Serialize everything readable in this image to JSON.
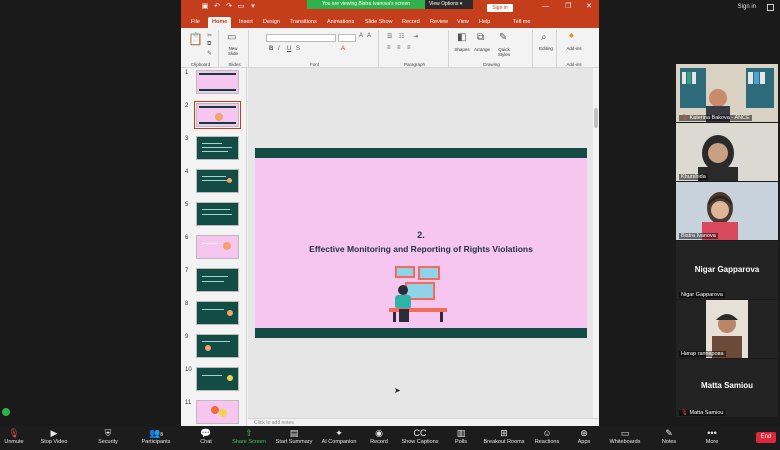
{
  "zoom_top": {
    "signin": "Sign in"
  },
  "ppt": {
    "banner": "You are viewing Bistra Ivanova's screen",
    "view_options": "View Options",
    "signin": "Sign in",
    "tabs": [
      "File",
      "Home",
      "Insert",
      "Design",
      "Transitions",
      "Animations",
      "Slide Show",
      "Record",
      "Review",
      "View",
      "Help",
      "Tell me"
    ],
    "ribbon": {
      "clipboard": "Clipboard",
      "slides": "Slides",
      "new_slide": "New Slide",
      "font": "Font",
      "paragraph": "Paragraph",
      "drawing": "Drawing",
      "shapes": "Shapes",
      "arrange": "Arrange",
      "quick_styles": "Quick Styles",
      "editing": "Editing",
      "addins": "Add-ins",
      "addins_group": "Add-ins"
    },
    "thumbnails": [
      "1",
      "2",
      "3",
      "4",
      "5",
      "6",
      "7",
      "8",
      "9",
      "10",
      "11"
    ],
    "slide": {
      "number": "2.",
      "title": "Effective Monitoring and Reporting of Rights Violations"
    },
    "notes_placeholder": "Click to add notes"
  },
  "participants": [
    {
      "name": "Katerina Bakova - ANCE",
      "muted": true
    },
    {
      "name": "Khurshida",
      "muted": false
    },
    {
      "name": "Bistra Ivanova",
      "muted": false
    },
    {
      "name": "Nigar Gapparova",
      "big_name": "Nigar Gapparova"
    },
    {
      "name": "Нигар гаппарова"
    },
    {
      "name": "Matta Samiou",
      "big_name": "Matta Samiou",
      "muted": true
    }
  ],
  "toolbar": {
    "unmute": "Unmute",
    "stop_video": "Stop Video",
    "security": "Security",
    "participants": "Participants",
    "participants_count": "8",
    "chat": "Chat",
    "share_screen": "Share Screen",
    "start_summary": "Start Summary",
    "ai_companion": "AI Companion",
    "record": "Record",
    "show_captions": "Show Captions",
    "polls": "Polls",
    "breakout_rooms": "Breakout Rooms",
    "reactions": "Reactions",
    "apps": "Apps",
    "whiteboards": "Whiteboards",
    "notes": "Notes",
    "more": "More",
    "end": "End"
  },
  "colors": {
    "ppt_accent": "#c43e1c",
    "slide_bg": "#f7c6f0",
    "slide_bar": "#134b45",
    "zoom_green": "#2fb24c",
    "end_red": "#e0263a"
  }
}
